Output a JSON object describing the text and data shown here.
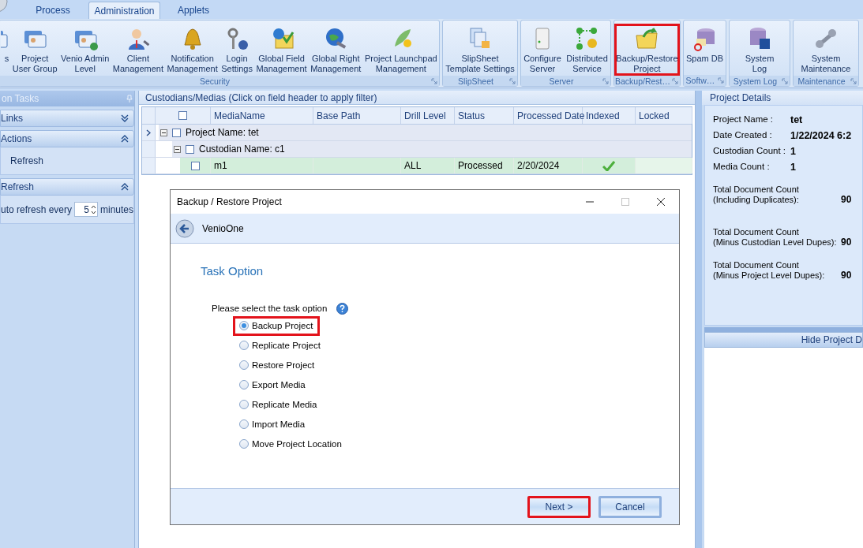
{
  "tabs": [
    {
      "label": "Process",
      "selected": false
    },
    {
      "label": "Administration",
      "selected": true
    },
    {
      "label": "Applets",
      "selected": false
    }
  ],
  "ribbon": [
    {
      "label": "Security",
      "buttons": [
        {
          "label": "s",
          "highlighted": false
        },
        {
          "label": "Project\nUser Group",
          "highlighted": false
        },
        {
          "label": "Venio Admin\nLevel",
          "highlighted": false
        },
        {
          "label": "Client\nManagement",
          "highlighted": false
        },
        {
          "label": "Notification\nManagement",
          "highlighted": false
        },
        {
          "label": "Login\nSettings",
          "highlighted": false
        },
        {
          "label": "Global Field\nManagement",
          "highlighted": false
        },
        {
          "label": "Global Right\nManagement",
          "highlighted": false
        },
        {
          "label": "Project Launchpad\nManagement",
          "highlighted": false
        }
      ]
    },
    {
      "label": "SlipSheet",
      "buttons": [
        {
          "label": "SlipSheet\nTemplate Settings",
          "highlighted": false
        }
      ]
    },
    {
      "label": "Server",
      "buttons": [
        {
          "label": "Configure\nServer",
          "highlighted": false
        },
        {
          "label": "Distributed\nService",
          "highlighted": false
        }
      ]
    },
    {
      "label": "Backup/Rest…",
      "buttons": [
        {
          "label": "Backup/Restore\nProject",
          "highlighted": true
        }
      ]
    },
    {
      "label": "Softw…",
      "buttons": [
        {
          "label": "Spam DB",
          "highlighted": false
        }
      ]
    },
    {
      "label": "System Log",
      "buttons": [
        {
          "label": "System\nLog",
          "highlighted": false
        }
      ]
    },
    {
      "label": "Maintenance",
      "buttons": [
        {
          "label": "System\nMaintenance",
          "highlighted": false
        }
      ]
    }
  ],
  "left_pane": {
    "title": "on Tasks",
    "sections": [
      {
        "title": "Links",
        "expanded": false
      },
      {
        "title": "Actions",
        "expanded": true,
        "items": [
          "Refresh"
        ]
      },
      {
        "title": "Refresh",
        "expanded": true,
        "auto_refresh": {
          "before": "uto refresh every",
          "value": "5",
          "after": "minutes"
        }
      }
    ]
  },
  "grid": {
    "title": "Custodians/Medias (Click on field header to apply filter)",
    "header_checked": false,
    "columns": [
      "MediaName",
      "Base Path",
      "Drill Level",
      "Status",
      "Processed Date",
      "Indexed",
      "Locked"
    ],
    "rows": [
      {
        "kind": "group",
        "label": "Project Name: tet",
        "expanded": true,
        "checked": false,
        "current": true,
        "children": [
          {
            "kind": "group",
            "label": "Custodian Name: c1",
            "expanded": true,
            "checked": false,
            "current": false,
            "children": [
              {
                "kind": "media",
                "checked": false,
                "current": false,
                "media_name": "m1",
                "drill_level": "ALL",
                "status": "Processed",
                "processed_date": "2/20/2024",
                "indexed": true,
                "locked": false
              }
            ]
          }
        ]
      }
    ]
  },
  "details": {
    "title": "Project Details",
    "fields": [
      {
        "label": "Project Name :",
        "value": "tet"
      },
      {
        "label": "Date Created :",
        "value": "1/22/2024 6:2"
      },
      {
        "label": "Custodian Count :",
        "value": "1"
      },
      {
        "label": "Media Count :",
        "value": "1"
      }
    ],
    "totals": [
      {
        "label": "Total Document Count\n(Including Duplicates):",
        "value": "90"
      },
      {
        "label": "Total Document Count\n(Minus Custodian Level Dupes):",
        "value": "90"
      },
      {
        "label": "Total Document Count\n(Minus Project Level Dupes):",
        "value": "90"
      }
    ],
    "hide_button": "Hide Project D"
  },
  "dialog": {
    "title": "Backup / Restore Project",
    "maximize_disabled": true,
    "nav_title": "VenioOne",
    "heading": "Task Option",
    "prompt": "Please select the task option",
    "options": [
      {
        "label": "Backup Project",
        "selected": true,
        "highlighted": true
      },
      {
        "label": "Replicate Project",
        "selected": false,
        "highlighted": false
      },
      {
        "label": "Restore Project",
        "selected": false,
        "highlighted": false
      },
      {
        "label": "Export Media",
        "selected": false,
        "highlighted": false
      },
      {
        "label": "Replicate Media",
        "selected": false,
        "highlighted": false
      },
      {
        "label": "Import Media",
        "selected": false,
        "highlighted": false
      },
      {
        "label": "Move Project Location",
        "selected": false,
        "highlighted": false
      }
    ],
    "buttons": [
      {
        "label": "Next >",
        "highlighted": true
      },
      {
        "label": "Cancel",
        "highlighted": false
      }
    ]
  }
}
